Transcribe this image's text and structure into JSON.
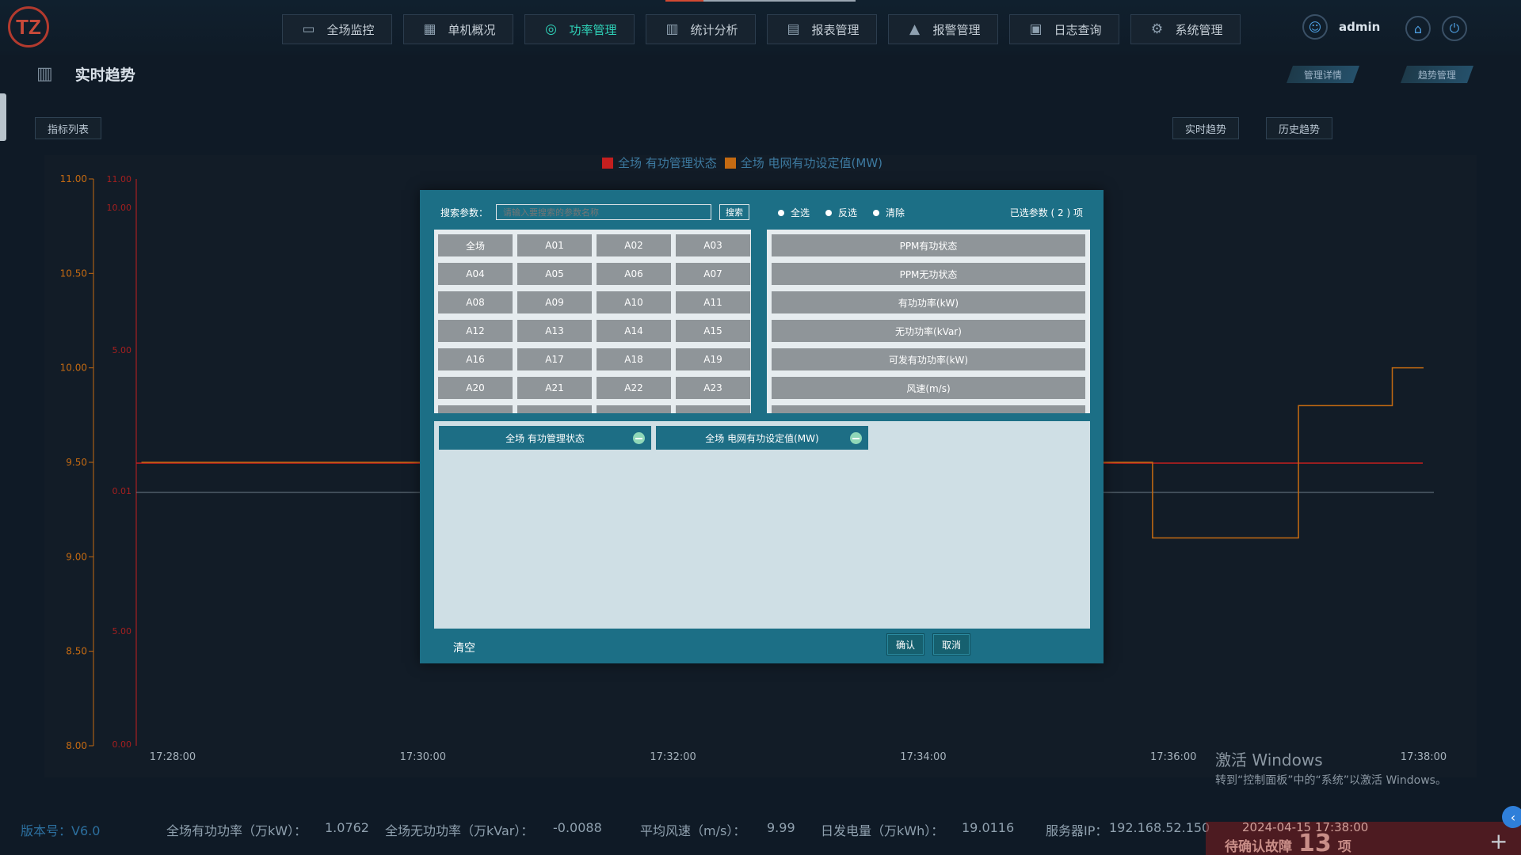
{
  "app": {
    "logo": "TZ"
  },
  "nav": [
    {
      "label": "全场监控",
      "icon": "monitor-icon"
    },
    {
      "label": "单机概况",
      "icon": "grid-icon"
    },
    {
      "label": "功率管理",
      "icon": "power-wave-icon",
      "active": true
    },
    {
      "label": "统计分析",
      "icon": "bar-chart-icon"
    },
    {
      "label": "报表管理",
      "icon": "clipboard-icon"
    },
    {
      "label": "报警管理",
      "icon": "warning-icon"
    },
    {
      "label": "日志查询",
      "icon": "log-icon"
    },
    {
      "label": "系统管理",
      "icon": "settings-users-icon"
    }
  ],
  "user": {
    "name": "admin"
  },
  "page": {
    "title": "实时趋势",
    "tags": [
      "管理详情",
      "趋势管理"
    ],
    "indicator_list_label": "指标列表",
    "realtime_label": "实时趋势",
    "history_label": "历史趋势"
  },
  "chart_data": {
    "type": "line",
    "title": "",
    "series": [
      {
        "name": "全场 有功管理状态",
        "color": "#c41f1f",
        "y_axis": "right",
        "x": [
          "17:28:00",
          "17:30:00",
          "17:32:00",
          "17:34:00",
          "17:36:00",
          "17:38:00"
        ],
        "values": [
          1,
          1,
          1,
          1,
          1,
          1
        ]
      },
      {
        "name": "全场 电网有功设定值(MW)",
        "color": "#c46a12",
        "y_axis": "left",
        "x": [
          "17:27:45",
          "17:35:40",
          "17:35:50",
          "17:36:50",
          "17:37:00",
          "17:37:35",
          "17:37:45",
          "17:38:00"
        ],
        "values": [
          9.5,
          9.5,
          9.1,
          9.1,
          9.8,
          9.8,
          10.0,
          10.0
        ]
      }
    ],
    "y_left": {
      "ticks": [
        "11.00",
        "10.50",
        "10.00",
        "9.50",
        "9.00",
        "8.50",
        "8.00"
      ],
      "ylim": [
        8.0,
        11.0
      ]
    },
    "y_right": {
      "ticks": [
        "11.00",
        "10.00",
        "5.00",
        "0.01",
        "5.00",
        "0.00"
      ]
    },
    "x_ticks": [
      "17:28:00",
      "17:30:00",
      "17:32:00",
      "17:34:00",
      "17:36:00",
      "17:38:00"
    ],
    "legend_position": "top-center"
  },
  "modal": {
    "search_label": "搜索参数：",
    "search_placeholder": "请输入要搜索的参数名称",
    "search_button": "搜索",
    "radio_all": "全选",
    "radio_invert": "反选",
    "radio_clear": "清除",
    "selected_count_text": "已选参数 ( 2 ) 项",
    "units": [
      "全场",
      "A01",
      "A02",
      "A03",
      "A04",
      "A05",
      "A06",
      "A07",
      "A08",
      "A09",
      "A10",
      "A11",
      "A12",
      "A13",
      "A14",
      "A15",
      "A16",
      "A17",
      "A18",
      "A19",
      "A20",
      "A21",
      "A22",
      "A23"
    ],
    "metrics": [
      "PPM有功状态",
      "PPM无功状态",
      "有功功率(kW)",
      "无功功率(kVar)",
      "可发有功功率(kW)",
      "风速(m/s)"
    ],
    "selected": [
      "全场 有功管理状态",
      "全场 电网有功设定值(MW)"
    ],
    "clear_all": "清空",
    "confirm": "确认",
    "cancel": "取消"
  },
  "watermark": {
    "line1": "激活 Windows",
    "line2": "转到“控制面板”中的“系统”以激活 Windows。"
  },
  "status": {
    "version": "版本号：V6.0",
    "active_power_label": "全场有功功率（万kW）：",
    "active_power": "1.0762",
    "reactive_power_label": "全场无功功率（万kVar）：",
    "reactive_power": "-0.0088",
    "wind_label": "平均风速（m/s）：",
    "wind": "9.99",
    "energy_label": "日发电量（万kWh）：",
    "energy": "19.0116",
    "server_label": "服务器IP：",
    "server_ip": "192.168.52.150",
    "datetime": "2024-04-15 17:38:00",
    "fault_label": "待确认故障",
    "fault_count": "13",
    "fault_unit": "项"
  },
  "colors": {
    "accent": "#2fd2b8",
    "modal_bg": "#1c6f86",
    "series_red": "#c41f1f",
    "series_orange": "#c46a12"
  }
}
